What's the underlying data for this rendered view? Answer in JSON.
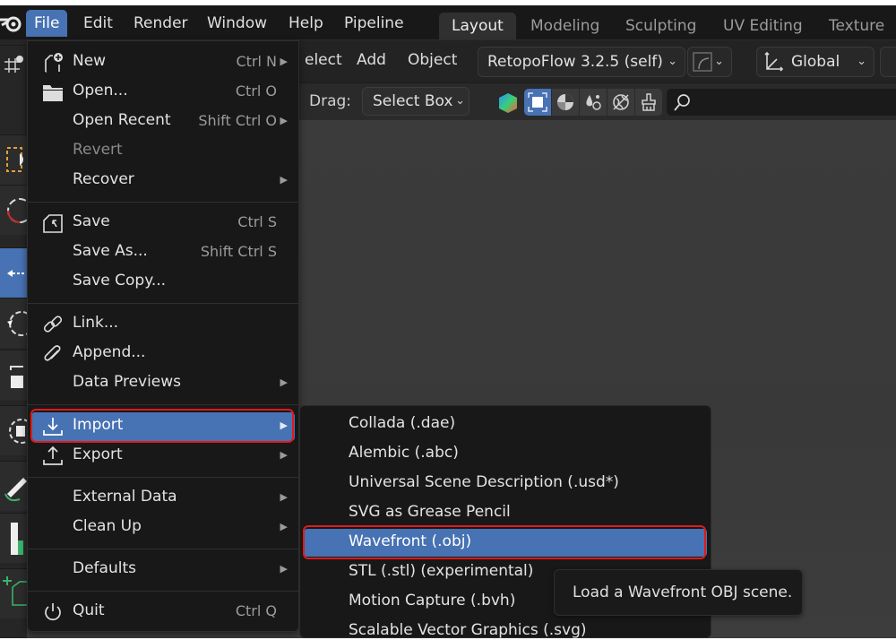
{
  "topbar": {
    "logo": "blender-logo-icon",
    "menus": [
      "File",
      "Edit",
      "Render",
      "Window",
      "Help",
      "Pipeline"
    ],
    "active_menu": "File",
    "workspaces": [
      "Layout",
      "Modeling",
      "Sculpting",
      "UV Editing",
      "Texture P"
    ],
    "active_workspace": "Layout"
  },
  "header": {
    "menus": [
      "elect",
      "Add",
      "Object"
    ],
    "addon_dropdown": "RetopoFlow 3.2.5 (self)",
    "transform_orientation": "Global",
    "drag_label": "Drag:",
    "drag_value": "Select Box",
    "shading_icons": [
      "color-hexagon-icon",
      "select-box-icon",
      "shading-icon",
      "droplet-icon",
      "world-icon",
      "brush-icon"
    ],
    "search_icon": "search-icon"
  },
  "file_menu": {
    "items": [
      {
        "label": "New",
        "shortcut": "Ctrl N",
        "submenu": true,
        "icon": "new-file-icon"
      },
      {
        "label": "Open...",
        "shortcut": "Ctrl O",
        "submenu": false,
        "icon": "folder-icon"
      },
      {
        "label": "Open Recent",
        "shortcut": "Shift Ctrl O",
        "submenu": true,
        "icon": ""
      },
      {
        "label": "Revert",
        "shortcut": "",
        "submenu": false,
        "icon": "",
        "disabled": true
      },
      {
        "label": "Recover",
        "shortcut": "",
        "submenu": true,
        "icon": ""
      },
      {
        "label": "Save",
        "shortcut": "Ctrl S",
        "submenu": false,
        "icon": "save-icon"
      },
      {
        "label": "Save As...",
        "shortcut": "Shift Ctrl S",
        "submenu": false,
        "icon": ""
      },
      {
        "label": "Save Copy...",
        "shortcut": "",
        "submenu": false,
        "icon": ""
      },
      {
        "label": "Link...",
        "shortcut": "",
        "submenu": false,
        "icon": "link-icon"
      },
      {
        "label": "Append...",
        "shortcut": "",
        "submenu": false,
        "icon": "paperclip-icon"
      },
      {
        "label": "Data Previews",
        "shortcut": "",
        "submenu": true,
        "icon": ""
      },
      {
        "label": "Import",
        "shortcut": "",
        "submenu": true,
        "icon": "import-icon",
        "highlighted": true
      },
      {
        "label": "Export",
        "shortcut": "",
        "submenu": true,
        "icon": "export-icon"
      },
      {
        "label": "External Data",
        "shortcut": "",
        "submenu": true,
        "icon": ""
      },
      {
        "label": "Clean Up",
        "shortcut": "",
        "submenu": true,
        "icon": ""
      },
      {
        "label": "Defaults",
        "shortcut": "",
        "submenu": true,
        "icon": ""
      },
      {
        "label": "Quit",
        "shortcut": "Ctrl Q",
        "submenu": false,
        "icon": "power-icon"
      }
    ]
  },
  "import_submenu": {
    "items": [
      {
        "label": "Collada (.dae)"
      },
      {
        "label": "Alembic (.abc)"
      },
      {
        "label": "Universal Scene Description (.usd*)"
      },
      {
        "label": "SVG as Grease Pencil"
      },
      {
        "label": "Wavefront (.obj)",
        "highlighted": true
      },
      {
        "label": "STL (.stl) (experimental)"
      },
      {
        "label": "Motion Capture (.bvh)"
      },
      {
        "label": "Scalable Vector Graphics (.svg)"
      }
    ]
  },
  "tooltip": {
    "text": "Load a Wavefront OBJ scene."
  },
  "colors": {
    "accent": "#4772b3",
    "annotation": "#e01a1a",
    "menu_bg": "#181818"
  }
}
